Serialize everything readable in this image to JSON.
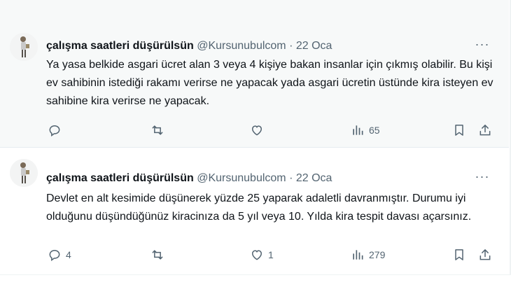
{
  "tweets": [
    {
      "author_name": "çalışma saatleri düşürülsün",
      "handle": "@Kursunubulcom",
      "separator": "·",
      "date": "22 Oca",
      "more_label": "···",
      "text": "Ya yasa belkide asgari ücret alan 3 veya 4 kişiye bakan insanlar için çıkmış olabilir. Bu kişi ev sahibinin istediği rakamı verirse ne yapacak yada asgari ücretin üstünde kira isteyen ev sahibine kira verirse ne yapacak.",
      "reply_count": "",
      "retweet_count": "",
      "like_count": "",
      "view_count": "65"
    },
    {
      "author_name": "çalışma saatleri düşürülsün",
      "handle": "@Kursunubulcom",
      "separator": "·",
      "date": "22 Oca",
      "more_label": "···",
      "text": "Devlet en alt kesimide düşünerek yüzde 25 yaparak adaletli davranmıştır. Durumu iyi olduğunu düşündüğünüz kiracinıza da 5 yıl veya 10. Yıldа kira tespit davası açarsınız.",
      "reply_count": "4",
      "retweet_count": "",
      "like_count": "1",
      "view_count": "279"
    }
  ],
  "icons": {
    "reply": "reply-icon",
    "retweet": "retweet-icon",
    "like": "heart-icon",
    "views": "views-icon",
    "bookmark": "bookmark-icon",
    "share": "share-icon"
  },
  "colors": {
    "secondary_text": "#536471",
    "primary_text": "#0f1419",
    "hover_bg": "#f7f9f9"
  }
}
